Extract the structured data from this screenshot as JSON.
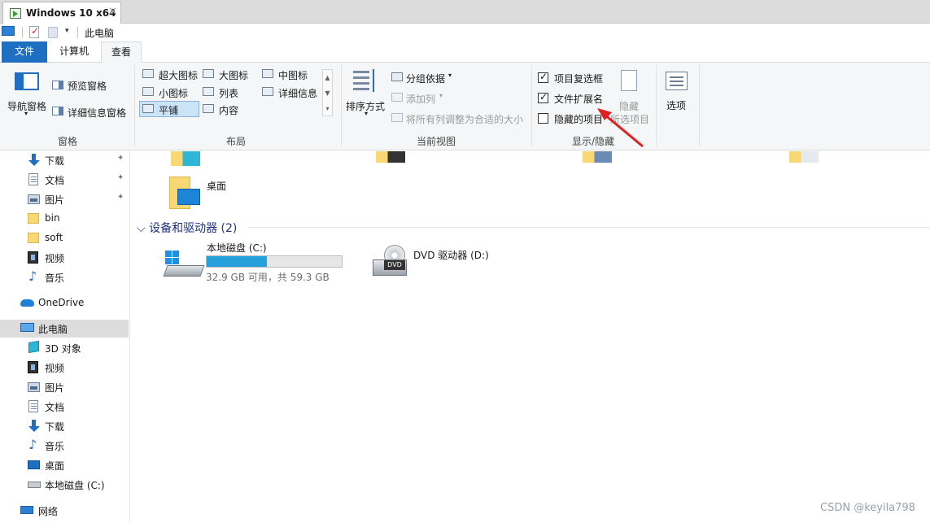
{
  "vm": {
    "tab_title": "Windows 10 x64",
    "close_glyph": "✕"
  },
  "qat": {
    "title": "此电脑",
    "dropdown_glyph": "▾"
  },
  "ribbon_tabs": [
    "文件",
    "计算机",
    "查看"
  ],
  "ribbon": {
    "panes": {
      "group_label": "窗格",
      "nav_pane": "导航窗格",
      "preview_pane": "预览窗格",
      "details_pane": "详细信息窗格"
    },
    "layout": {
      "group_label": "布局",
      "options": [
        "超大图标",
        "大图标",
        "中图标",
        "小图标",
        "列表",
        "详细信息",
        "平铺",
        "内容"
      ],
      "selected": "平铺",
      "scroll_up": "▲",
      "scroll_down": "▼",
      "scroll_more": "▾"
    },
    "current_view": {
      "group_label": "当前视图",
      "sort_by": "排序方式",
      "group_by": "分组依据",
      "add_columns": "添加列",
      "fit_columns": "将所有列调整为合适的大小"
    },
    "show_hide": {
      "group_label": "显示/隐藏",
      "item_checkboxes": {
        "label": "项目复选框",
        "checked": true
      },
      "file_extensions": {
        "label": "文件扩展名",
        "checked": true
      },
      "hidden_items": {
        "label": "隐藏的项目",
        "checked": false
      },
      "hide_selected_line1": "隐藏",
      "hide_selected_line2": "所选项目"
    },
    "options_label": "选项"
  },
  "nav": {
    "quick_access": [
      {
        "label": "下载",
        "icon": "download-icon",
        "pinned": true
      },
      {
        "label": "文档",
        "icon": "document-icon",
        "pinned": true
      },
      {
        "label": "图片",
        "icon": "picture-icon",
        "pinned": true
      },
      {
        "label": "bin",
        "icon": "folder-icon",
        "pinned": false
      },
      {
        "label": "soft",
        "icon": "folder-icon",
        "pinned": false
      },
      {
        "label": "视频",
        "icon": "video-icon",
        "pinned": false
      },
      {
        "label": "音乐",
        "icon": "music-icon",
        "pinned": false
      }
    ],
    "onedrive": "OneDrive",
    "this_pc": "此电脑",
    "this_pc_items": [
      {
        "label": "3D 对象",
        "icon": "3d-objects-icon"
      },
      {
        "label": "视频",
        "icon": "video-icon"
      },
      {
        "label": "图片",
        "icon": "picture-icon"
      },
      {
        "label": "文档",
        "icon": "document-icon"
      },
      {
        "label": "下载",
        "icon": "download-icon"
      },
      {
        "label": "音乐",
        "icon": "music-icon"
      },
      {
        "label": "桌面",
        "icon": "desktop-icon"
      },
      {
        "label": "本地磁盘 (C:)",
        "icon": "drive-icon"
      }
    ],
    "network": "网络",
    "pin_glyph": "📌"
  },
  "main": {
    "desktop_label": "桌面",
    "devices_header": "设备和驱动器 (2)",
    "collapse_glyph": "⌵",
    "drive_c": {
      "name": "本地磁盘 (C:)",
      "space": "32.9 GB 可用，共 59.3 GB",
      "used_fraction": 0.445
    },
    "drive_d": {
      "name": "DVD 驱动器 (D:)",
      "tag": "DVD"
    }
  },
  "colors": {
    "accent": "#1e6ec1",
    "selection": "#cce4f7",
    "drive_bar": "#26a0da",
    "annotation_arrow": "#e02020"
  },
  "watermark": "CSDN @keyila798"
}
